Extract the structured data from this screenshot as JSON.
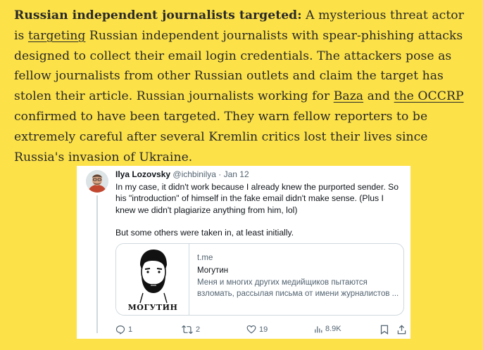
{
  "article": {
    "heading": "Russian independent journalists targeted:",
    "intro_a": " A mysterious threat actor is ",
    "link_targeting": "targeting",
    "intro_b": " Russian independent journalists with spear-phishing attacks designed to collect their email login credentials. The attackers pose as fellow journalists from other Russian outlets and claim the target has stolen their article. Russian journalists working for ",
    "link_baza": "Baza",
    "and": " and ",
    "link_occrp": "the OCCRP",
    "intro_c": " confirmed to have been targeted. They warn fellow reporters to be extremely careful after several Kremlin critics lost their lives since Russia's invasion of Ukraine."
  },
  "tweet": {
    "author": "Ilya Lozovsky",
    "handle": "@ichbinilya",
    "separator": " · ",
    "date": "Jan 12",
    "paragraph1": "In my case, it didn't work because I already knew the purported sender. So his \"introduction\" of himself in the fake email didn't make sense. (Plus I knew we didn't plagiarize anything from him, lol)",
    "paragraph2": "But some others were taken in, at least initially.",
    "card": {
      "domain": "t.me",
      "title": "Могутин",
      "desc_line1": "Меня и многих других медийщиков пытаются",
      "desc_line2": "взломать, рассылая письма от имени журналистов ...",
      "logo_text": "МОГУТИН"
    },
    "actions": {
      "replies": "1",
      "retweets": "2",
      "likes": "19",
      "views": "8.9K"
    }
  },
  "colors": {
    "background": "#fce148",
    "text": "#2a2a2a",
    "muted": "#536471",
    "border": "#cfd9de"
  }
}
